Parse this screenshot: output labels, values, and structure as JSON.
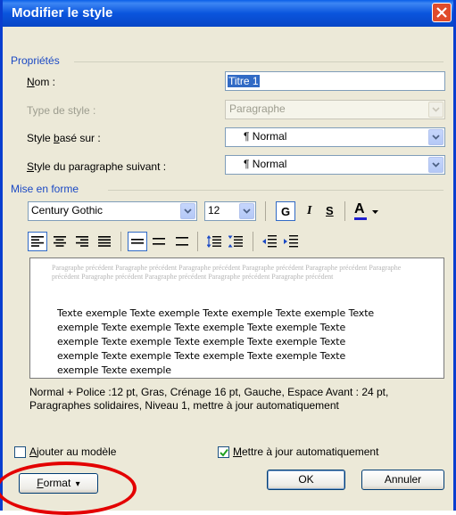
{
  "window": {
    "title": "Modifier le style",
    "title_color": "#0a55dd"
  },
  "properties": {
    "group_label": "Propriétés",
    "name_label_pre": "",
    "name_label_u": "N",
    "name_label_post": "om :",
    "name_value": "Titre 1",
    "type_label": "Type de style :",
    "type_value": "Paragraphe",
    "based_label_pre": "Style ",
    "based_label_u": "b",
    "based_label_post": "asé sur :",
    "based_value": "¶ Normal",
    "next_label_pre": "",
    "next_label_u": "S",
    "next_label_post": "tyle du paragraphe suivant :",
    "next_value": "¶ Normal"
  },
  "formatting": {
    "group_label": "Mise en forme",
    "font": "Century Gothic",
    "size": "12",
    "bold": "G",
    "italic": "I",
    "underline": "S",
    "font_color_letter": "A",
    "font_color": "#1f1fcf"
  },
  "preview": {
    "previous_paragraph": "Paragraphe précédent Paragraphe précédent Paragraphe précédent Paragraphe précédent Paragraphe précédent Paragraphe précédent Paragraphe précédent Paragraphe précédent Paragraphe précédent Paragraphe précédent",
    "sample_lines": [
      "Texte exemple Texte exemple Texte exemple Texte exemple Texte",
      "exemple Texte exemple Texte exemple Texte exemple Texte",
      "exemple Texte exemple Texte exemple Texte exemple Texte",
      "exemple Texte exemple Texte exemple Texte exemple Texte",
      "exemple Texte exemple"
    ]
  },
  "description": "Normal + Police :12 pt, Gras, Crénage 16 pt, Gauche, Espace Avant : 24 pt, Paragraphes solidaires, Niveau 1, mettre à jour automatiquement",
  "options": {
    "add_template_u": "A",
    "add_template_post": "jouter au modèle",
    "add_template_checked": false,
    "auto_update_u": "M",
    "auto_update_post": "ettre à jour automatiquement",
    "auto_update_checked": true
  },
  "buttons": {
    "format_u": "F",
    "format_post": "ormat",
    "format_arrow": "▾",
    "ok": "OK",
    "cancel": "Annuler"
  },
  "annotation": {
    "highlight_color": "#e30000"
  }
}
